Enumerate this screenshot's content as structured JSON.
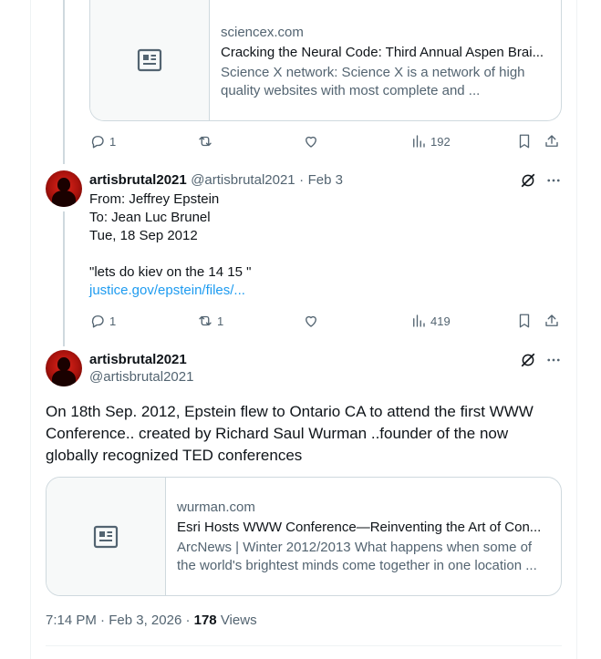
{
  "tweet1": {
    "card": {
      "domain": "sciencex.com",
      "title": "Cracking the Neural Code: Third Annual Aspen Brai...",
      "description": "Science X network: Science X is a network of high quality websites with most complete and ..."
    },
    "actions": {
      "replies": "1",
      "reposts": "",
      "views": "192"
    }
  },
  "tweet2": {
    "name": "artisbrutal2021",
    "handle": "@artisbrutal2021",
    "separator": "·",
    "date": "Feb 3",
    "lines": [
      "From: Jeffrey Epstein",
      "To: Jean Luc Brunel",
      "Tue, 18 Sep 2012",
      "",
      "\"lets do kiev on the 14 15 \""
    ],
    "link": "justice.gov/epstein/files/...",
    "actions": {
      "replies": "1",
      "reposts": "1",
      "views": "419"
    }
  },
  "tweet3": {
    "name": "artisbrutal2021",
    "handle": "@artisbrutal2021",
    "text": "On 18th Sep. 2012, Epstein flew to Ontario CA to attend the first WWW Conference.. created by Richard Saul Wurman ..founder of the now globally recognized TED conferences",
    "card": {
      "domain": "wurman.com",
      "title": "Esri Hosts WWW Conference—Reinventing the Art of Con...",
      "description": "ArcNews | Winter 2012/2013 What happens when some of the world's brightest minds come together in one location ..."
    },
    "time": "7:14 PM",
    "dot": "·",
    "date": "Feb 3, 2026",
    "views_count": "178",
    "views_label": "Views"
  },
  "colors": {
    "link": "#1d9bf0",
    "muted": "#536471",
    "text": "#0f1419",
    "border": "#cfd9de"
  },
  "icons": [
    "article-icon",
    "reply-icon",
    "repost-icon",
    "like-icon",
    "views-icon",
    "bookmark-icon",
    "share-icon",
    "grok-icon",
    "more-icon"
  ]
}
